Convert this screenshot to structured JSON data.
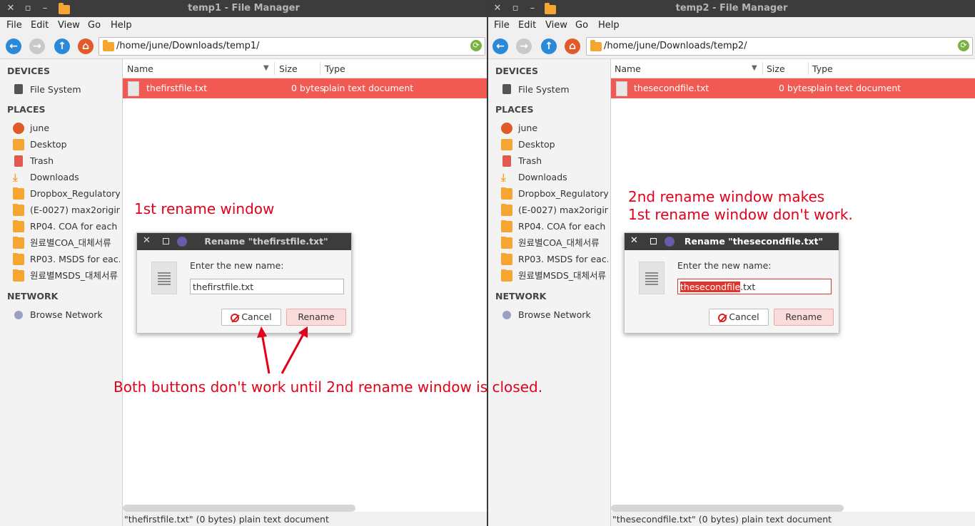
{
  "menu": [
    "File",
    "Edit",
    "View",
    "Go",
    "Help"
  ],
  "sidebar": {
    "devices_heading": "DEVICES",
    "devices": [
      "File System"
    ],
    "places_heading": "PLACES",
    "places": [
      "june",
      "Desktop",
      "Trash",
      "Downloads",
      "Dropbox_Regulatory...",
      "(E-0027) max2origin...",
      "RP04. COA for each i...",
      "원료별COA_대체서류",
      "RP03. MSDS for eac...",
      "원료별MSDS_대체서류"
    ],
    "network_heading": "NETWORK",
    "network": [
      "Browse Network"
    ]
  },
  "columns": {
    "name": "Name",
    "size": "Size",
    "type": "Type"
  },
  "win1": {
    "title": "temp1 - File Manager",
    "path": "/home/june/Downloads/temp1/",
    "file": {
      "name": "thefirstfile.txt",
      "size": "0 bytes",
      "type": "plain text document"
    },
    "status": "\"thefirstfile.txt\" (0 bytes) plain text document",
    "dialog": {
      "title": "Rename \"thefirstfile.txt\"",
      "prompt": "Enter the new name:",
      "value": "thefirstfile.txt",
      "cancel": "Cancel",
      "rename": "Rename"
    }
  },
  "win2": {
    "title": "temp2 - File Manager",
    "path": "/home/june/Downloads/temp2/",
    "file": {
      "name": "thesecondfile.txt",
      "size": "0 bytes",
      "type": "plain text document"
    },
    "status": "\"thesecondfile.txt\" (0 bytes) plain text document",
    "dialog": {
      "title": "Rename \"thesecondfile.txt\"",
      "prompt": "Enter the new name:",
      "value_selected": "thesecondfile",
      "value_rest": ".txt",
      "cancel": "Cancel",
      "rename": "Rename"
    }
  },
  "annotations": {
    "first": "1st rename window",
    "second_line1": "2nd rename window makes",
    "second_line2": "1st rename window don't work.",
    "bottom": "Both buttons don't work until 2nd rename window is closed."
  },
  "colors": {
    "accent": "#f15a52",
    "annotation": "#e3001b",
    "titlebar": "#3c3c3c"
  }
}
